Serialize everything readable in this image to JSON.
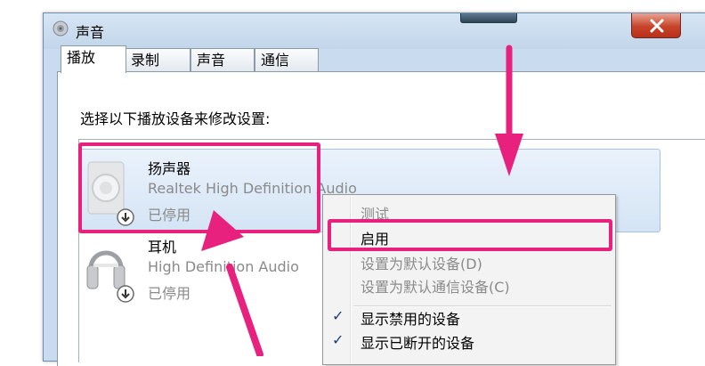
{
  "window": {
    "title": "声音",
    "title_icon": "speaker-icon",
    "close_icon": "close-icon"
  },
  "tabs": [
    {
      "label": "播放",
      "active": true
    },
    {
      "label": "录制",
      "active": false
    },
    {
      "label": "声音",
      "active": false
    },
    {
      "label": "通信",
      "active": false
    }
  ],
  "playback": {
    "instruction": "选择以下播放设备来修改设置:",
    "devices": [
      {
        "name": "扬声器",
        "driver": "Realtek High Definition Audio",
        "status": "已停用",
        "icon": "speaker-device-icon",
        "badge_icon": "disabled-down-arrow-icon"
      },
      {
        "name": "耳机",
        "driver": "High Definition Audio",
        "status": "已停用",
        "icon": "headphones-icon",
        "badge_icon": "disabled-down-arrow-icon"
      }
    ]
  },
  "context_menu": {
    "items": [
      {
        "label": "测试",
        "enabled": false,
        "checked": false
      },
      {
        "label": "启用",
        "enabled": true,
        "checked": false
      },
      {
        "label": "设置为默认设备(D)",
        "enabled": false,
        "checked": false
      },
      {
        "label": "设置为默认通信设备(C)",
        "enabled": false,
        "checked": false
      },
      {
        "label": "显示禁用的设备",
        "enabled": true,
        "checked": true
      },
      {
        "label": "显示已断开的设备",
        "enabled": true,
        "checked": true
      }
    ]
  },
  "colors": {
    "annotation": "#e8207e",
    "selection": "#d4e4f5",
    "disabled_text": "#8a8a8a"
  }
}
